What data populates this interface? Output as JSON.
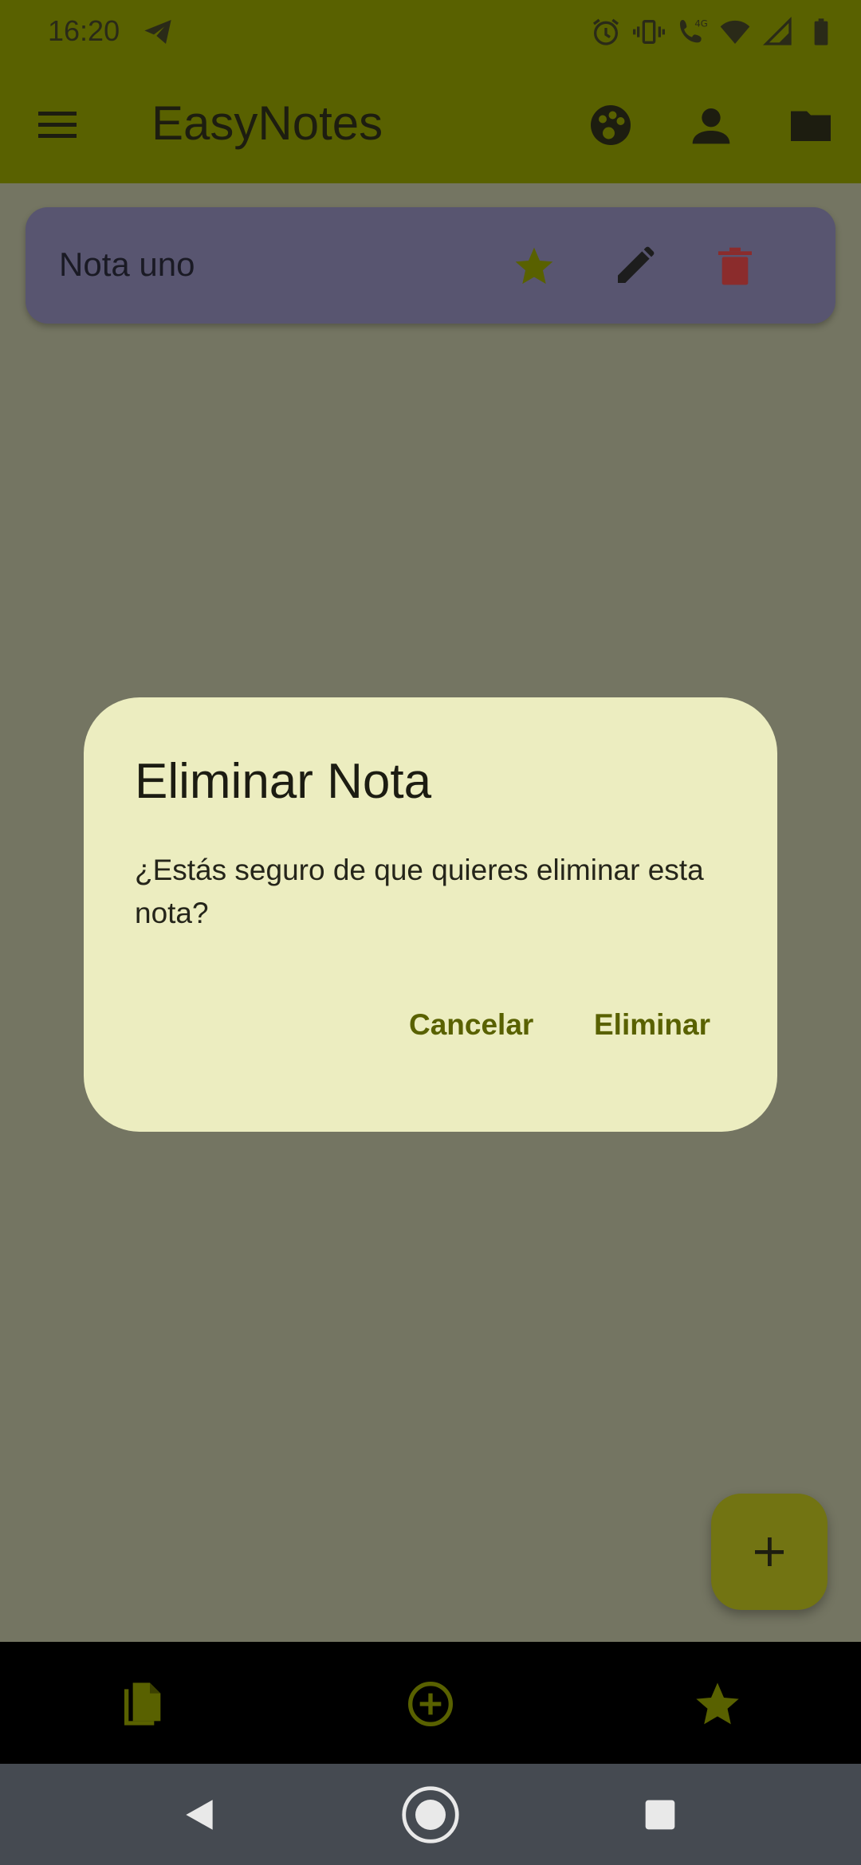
{
  "status_bar": {
    "time": "16:20",
    "icons": [
      "telegram-icon",
      "alarm-icon",
      "vibrate-icon",
      "volte-4g-icon",
      "wifi-icon",
      "signal-icon",
      "battery-icon"
    ]
  },
  "app_bar": {
    "title": "EasyNotes",
    "actions": [
      "palette-icon",
      "person-icon",
      "folder-icon"
    ]
  },
  "notes": [
    {
      "title": "Nota uno",
      "favorite": true
    }
  ],
  "dialog": {
    "title": "Eliminar Nota",
    "message": "¿Estás seguro de que quieres eliminar esta nota?",
    "cancel_label": "Cancelar",
    "confirm_label": "Eliminar"
  },
  "fab": {
    "icon": "plus-icon"
  },
  "bottom_nav": {
    "items": [
      "notes-copy-icon",
      "add-circle-icon",
      "star-icon"
    ]
  },
  "colors": {
    "primary": "#596100",
    "scrim_background": "#747562",
    "note_card": "#585570",
    "dialog_surface": "#ecedc0",
    "delete_red": "#8b2c2c",
    "favorite_star": "#596100"
  }
}
